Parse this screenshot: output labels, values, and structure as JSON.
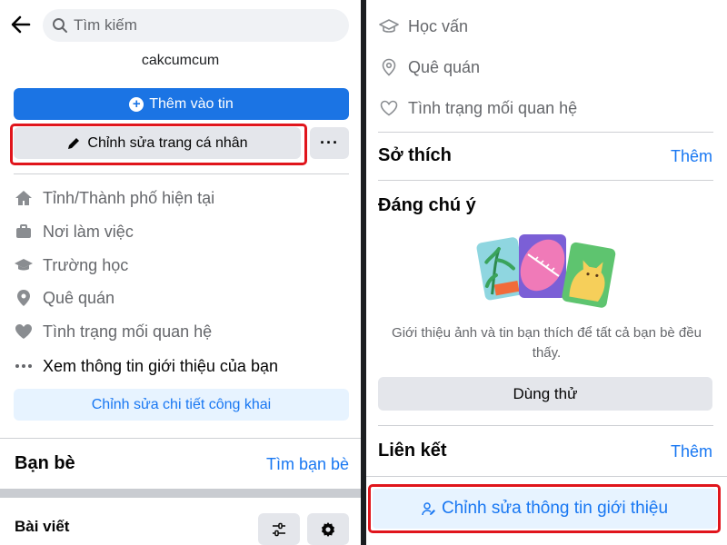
{
  "colors": {
    "primary": "#1b74e4",
    "link": "#1877f2",
    "light_button": "#e7f3ff",
    "gray_button": "#e4e6eb",
    "highlight_box": "#e0151c",
    "secondary_text": "#65676b"
  },
  "left": {
    "search": {
      "placeholder": "Tìm kiếm",
      "icon": "search-icon"
    },
    "profile": {
      "username": "cakcumcum"
    },
    "buttons": {
      "add_story": "Thêm vào tin",
      "edit_profile": "Chỉnh sửa trang cá nhân",
      "more": "···"
    },
    "details": [
      {
        "label": "Tỉnh/Thành phố hiện tại",
        "icon": "home-icon"
      },
      {
        "label": "Nơi làm việc",
        "icon": "briefcase-icon"
      },
      {
        "label": "Trường học",
        "icon": "graduation-cap-icon"
      },
      {
        "label": "Quê quán",
        "icon": "location-pin-icon"
      },
      {
        "label": "Tình trạng mối quan hệ",
        "icon": "heart-icon"
      },
      {
        "label": "Xem thông tin giới thiệu của bạn",
        "icon": "more-dots-icon"
      }
    ],
    "edit_public_details": "Chỉnh sửa chi tiết công khai",
    "friends": {
      "title": "Bạn bè",
      "find_link": "Tìm bạn bè"
    },
    "posts": {
      "title": "Bài viết"
    }
  },
  "right": {
    "rows": [
      {
        "label": "Học vấn",
        "icon": "graduation-cap-outline-icon"
      },
      {
        "label": "Quê quán",
        "icon": "location-pin-outline-icon"
      },
      {
        "label": "Tình trạng mối quan hệ",
        "icon": "heart-outline-icon"
      }
    ],
    "hobbies": {
      "title": "Sở thích",
      "link": "Thêm"
    },
    "featured": {
      "title": "Đáng chú ý",
      "description": "Giới thiệu ảnh và tin bạn thích để tất cả bạn bè đều thấy.",
      "try_button": "Dùng thử"
    },
    "links": {
      "title": "Liên kết",
      "link": "Thêm"
    },
    "edit_intro": "Chỉnh sửa thông tin giới thiệu"
  }
}
